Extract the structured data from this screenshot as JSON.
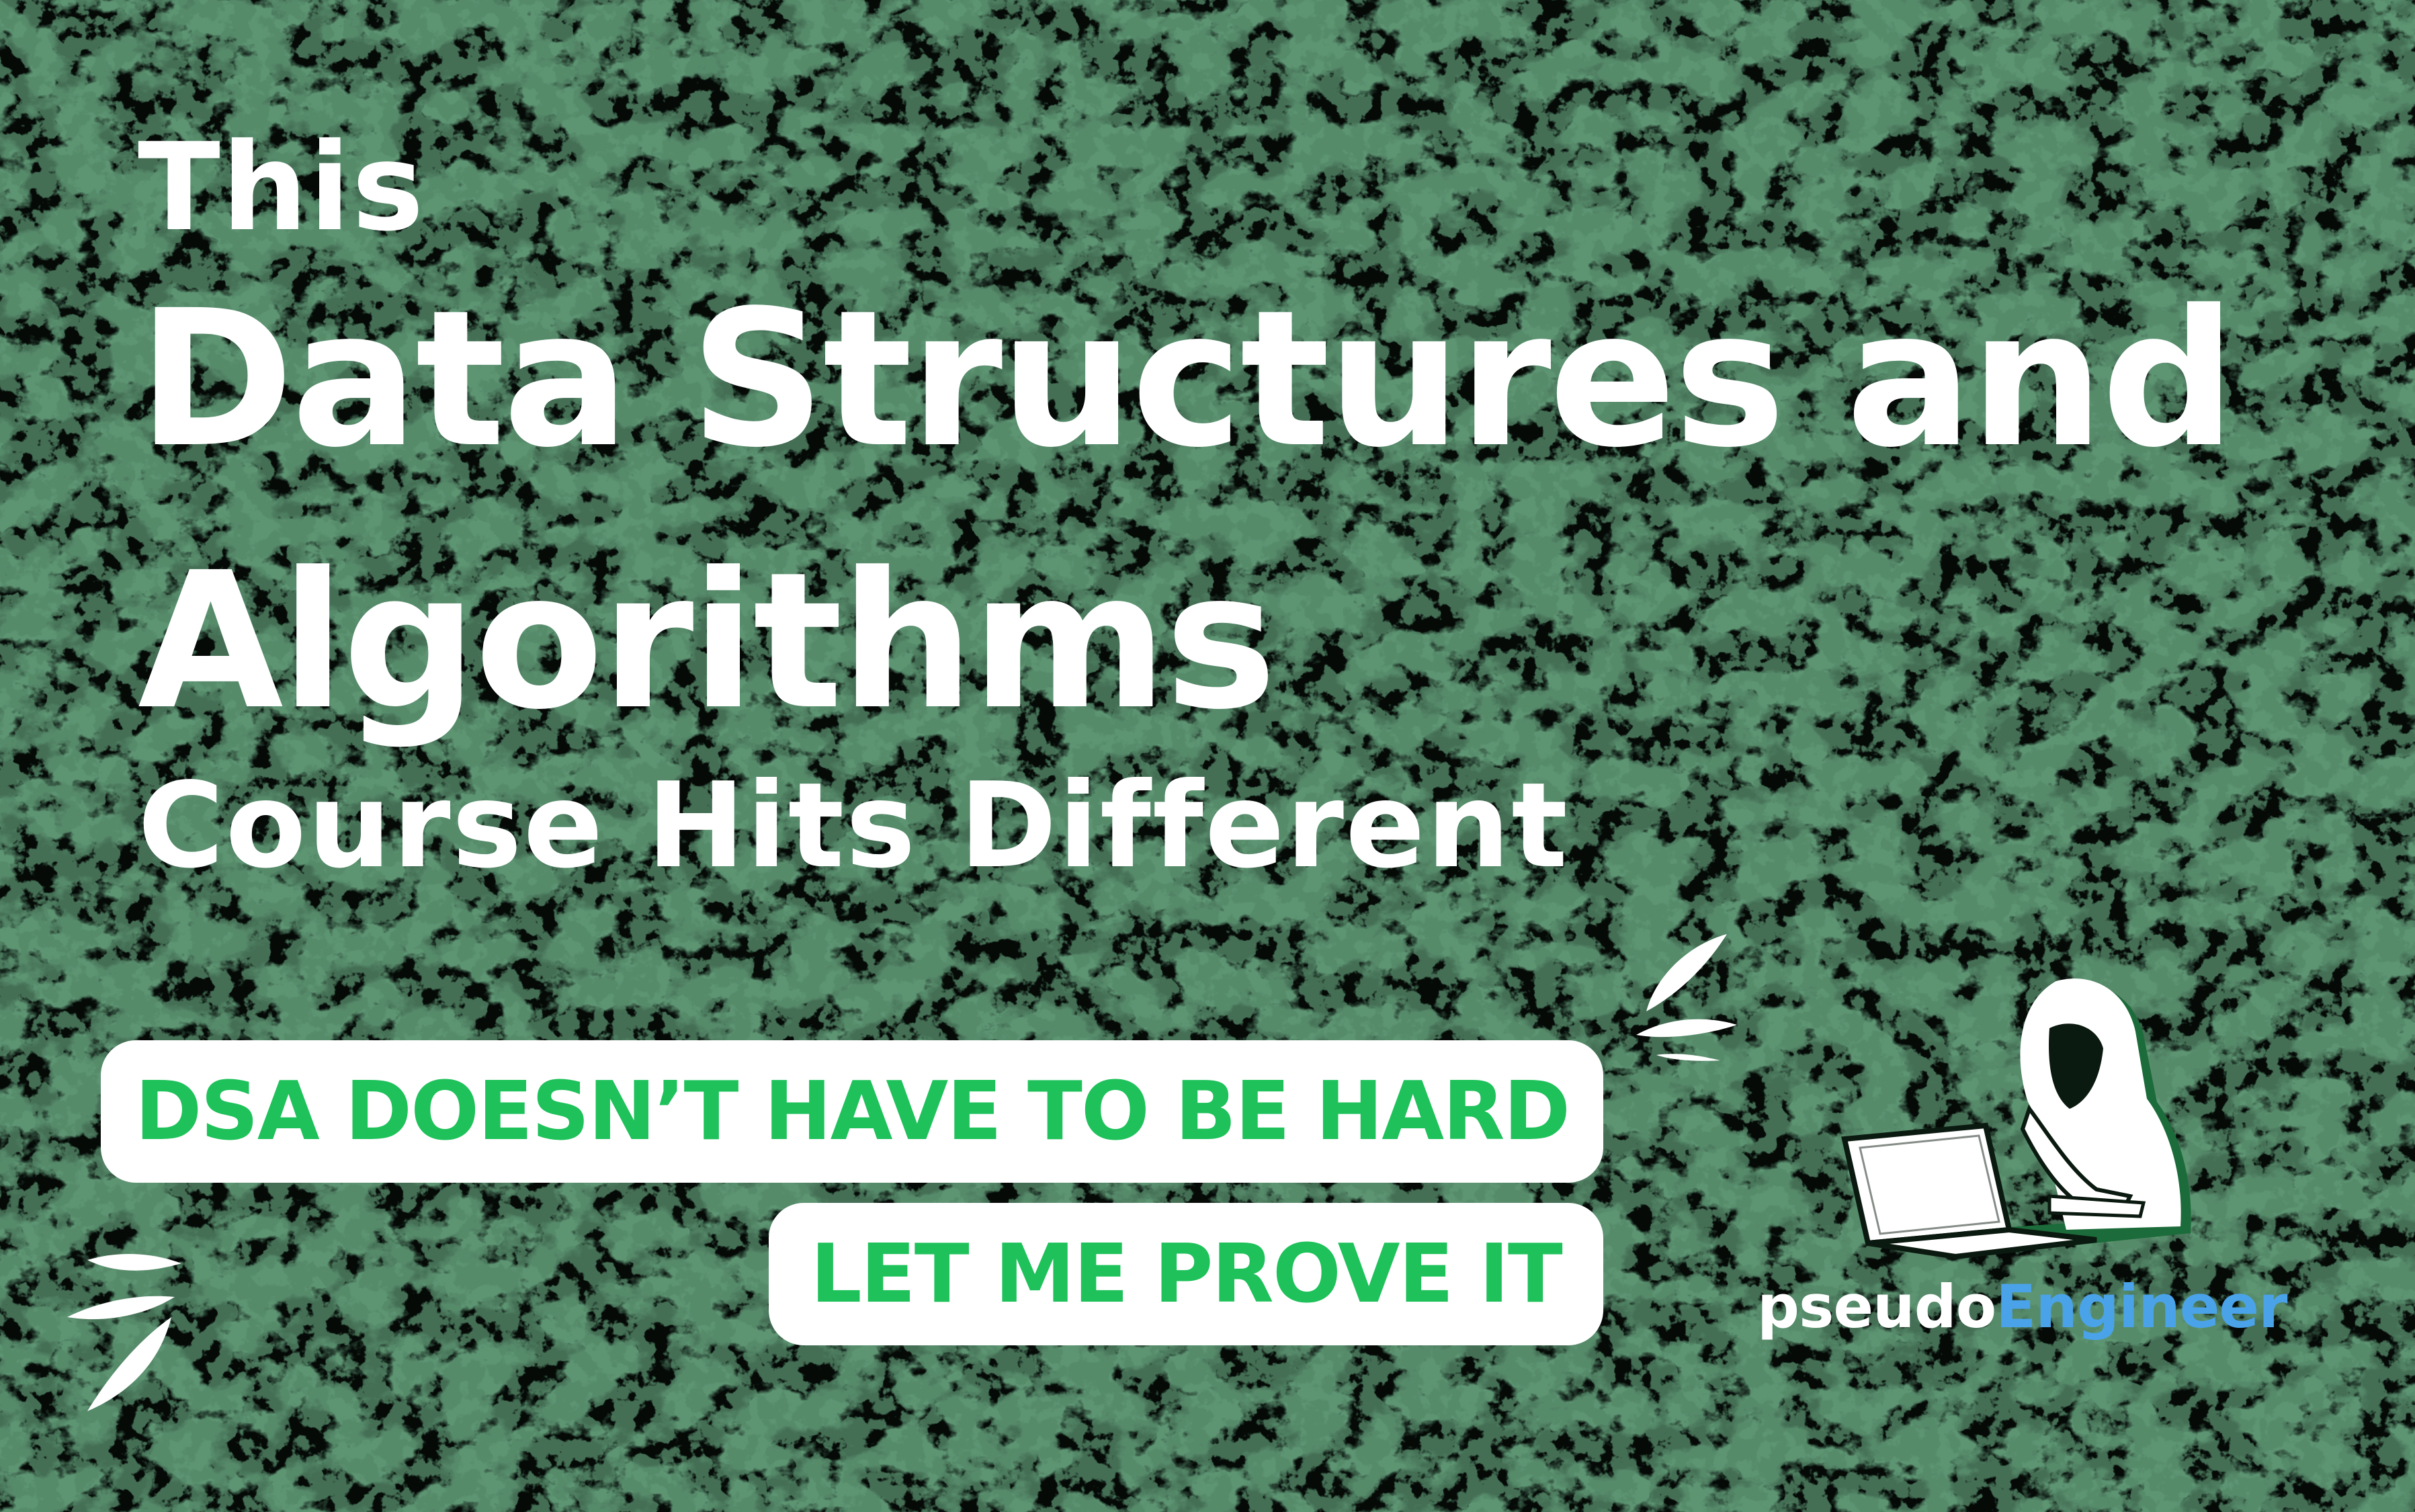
{
  "headline": {
    "line1": "This",
    "line2": "Data Structures and",
    "line3": "Algorithms",
    "line4": "Course Hits Different"
  },
  "pills": {
    "primary": "DSA DOESN’T HAVE TO BE HARD",
    "secondary": "LET ME PROVE IT"
  },
  "brand": {
    "part1": "pseudo",
    "part2": "Engineer"
  },
  "colors": {
    "background": "#050a07",
    "texture": "#1c4a2c",
    "headline_text": "#ffffff",
    "pill_background": "#ffffff",
    "pill_text": "#1ec15a",
    "brand_accent": "#4aa3e8"
  },
  "icons": {
    "logo": "hooded-coder-laptop-icon",
    "splash_top": "splash-lines-icon",
    "splash_bottom": "splash-lines-icon"
  }
}
